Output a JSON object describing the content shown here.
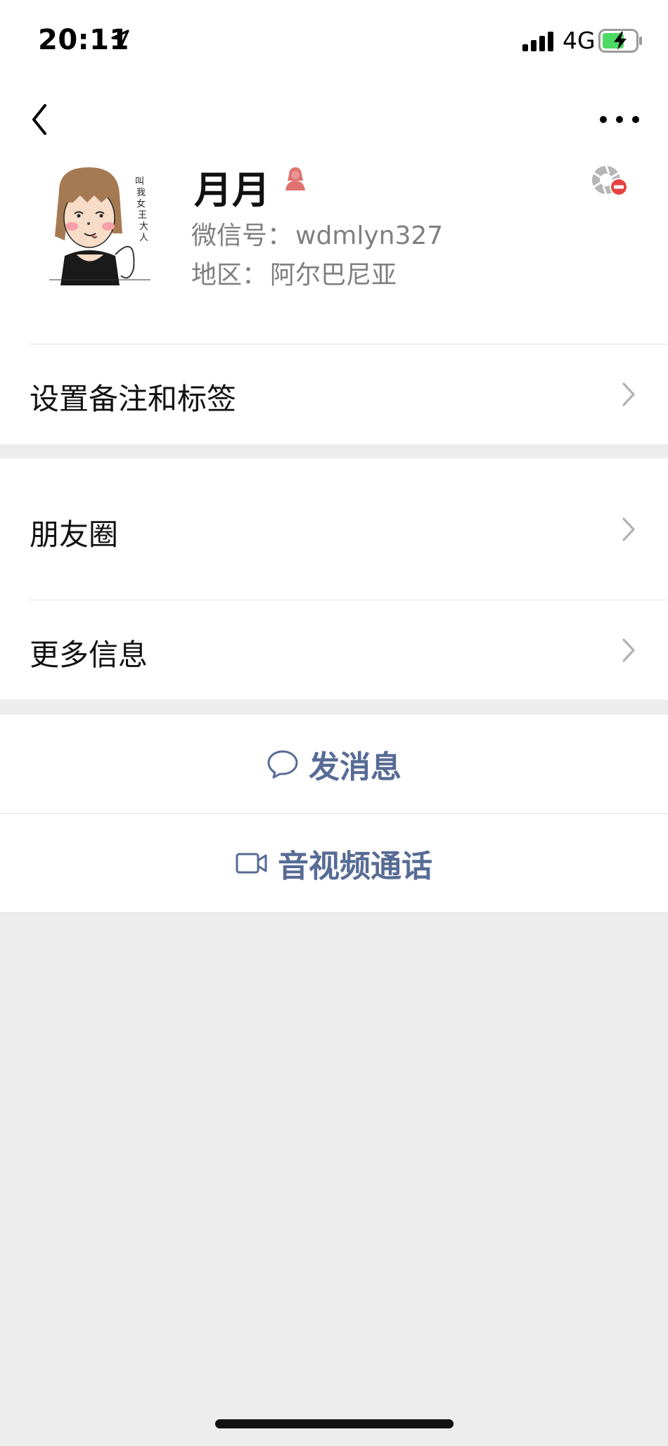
{
  "status_bar": {
    "time": "20:11",
    "network": "4G",
    "icons": [
      "location-arrow-icon",
      "signal-icon",
      "battery-charging-icon"
    ]
  },
  "nav": {
    "back_icon": "chevron-left-icon",
    "more_icon": "ellipsis-icon"
  },
  "profile": {
    "name": "月月",
    "gender_icon": "female-icon",
    "gender_color": "#fa5151",
    "wechat_id_label": "微信号：",
    "wechat_id": "wdmlyn327",
    "region_label": "地区：",
    "region": "阿尔巴尼亚",
    "avatar_text": "叫我女王大人",
    "moments_blocked_icon": "moments-blocked-icon"
  },
  "rows": {
    "remark_tags": "设置备注和标签",
    "moments": "朋友圈",
    "more_info": "更多信息"
  },
  "actions": {
    "send_message": "发消息",
    "send_message_icon": "chat-bubble-icon",
    "video_call": "音视频通话",
    "video_call_icon": "video-camera-icon",
    "accent_color": "#576b95"
  }
}
